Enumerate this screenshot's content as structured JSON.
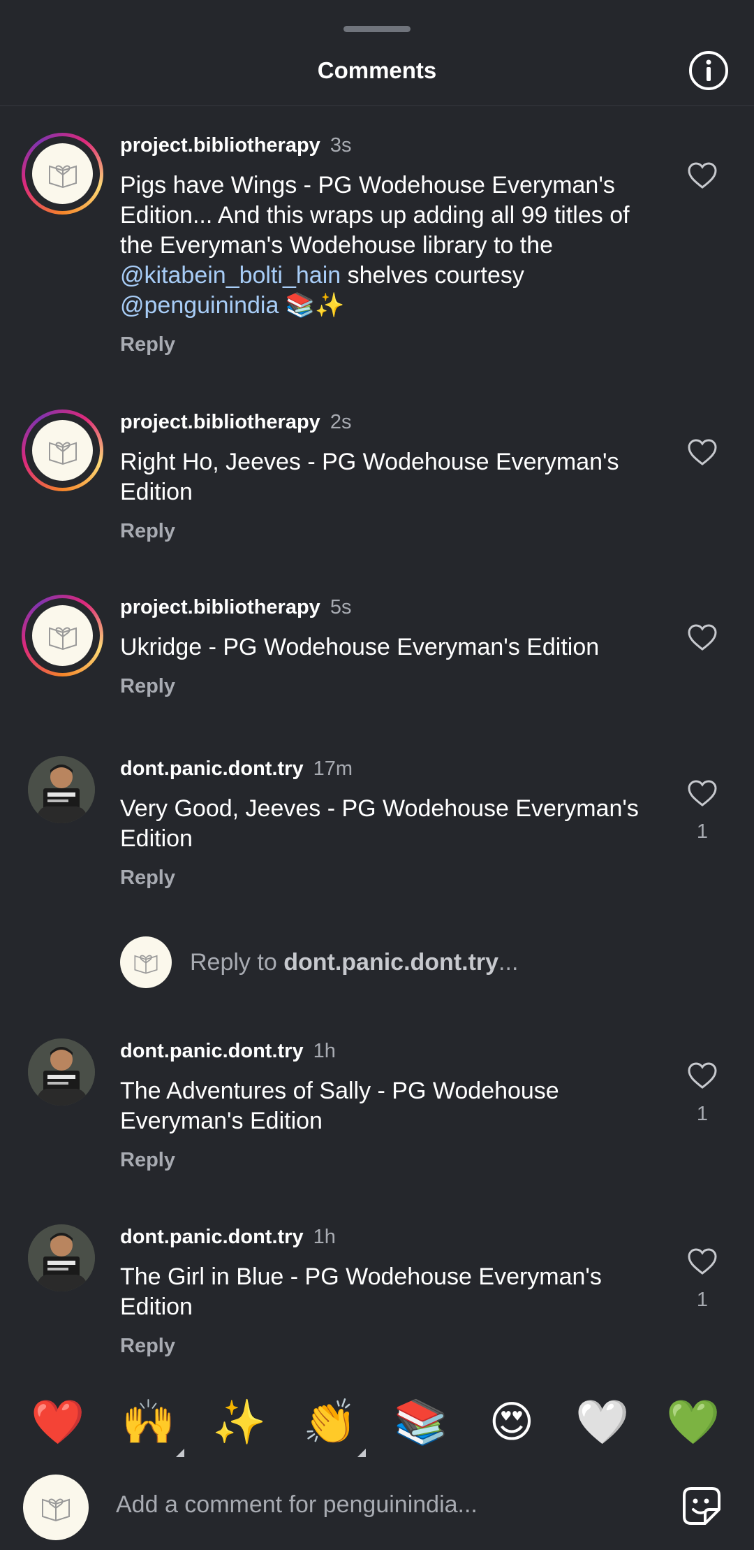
{
  "header": {
    "title": "Comments",
    "info_icon": "info-icon"
  },
  "comments": [
    {
      "username": "project.bibliotherapy",
      "time": "3s",
      "text_before": "Pigs have Wings - PG Wodehouse Everyman's Edition... And this wraps up adding all 99 titles of the Everyman's Wodehouse library to the ",
      "mention1": "@kitabein_bolti_hain",
      "text_middle": " shelves courtesy ",
      "mention2": "@penguinindia",
      "text_after": " 📚✨",
      "reply": "Reply"
    },
    {
      "username": "project.bibliotherapy",
      "time": "2s",
      "text": "Right Ho, Jeeves - PG Wodehouse Everyman's Edition",
      "reply": "Reply"
    },
    {
      "username": "project.bibliotherapy",
      "time": "5s",
      "text": "Ukridge - PG Wodehouse Everyman's Edition",
      "reply": "Reply"
    },
    {
      "username": "dont.panic.dont.try",
      "time": "17m",
      "text": "Very Good, Jeeves - PG Wodehouse Everyman's Edition",
      "reply": "Reply",
      "likes": "1"
    },
    {
      "username": "dont.panic.dont.try",
      "time": "1h",
      "text": "The Adventures of Sally - PG Wodehouse Everyman's Edition",
      "reply": "Reply",
      "likes": "1"
    },
    {
      "username": "dont.panic.dont.try",
      "time": "1h",
      "text": "The Girl in Blue - PG Wodehouse Everyman's Edition",
      "reply": "Reply",
      "likes": "1"
    }
  ],
  "reply_input": {
    "prefix": "Reply to ",
    "target": "dont.panic.dont.try",
    "suffix": "..."
  },
  "emoji_bar": [
    "❤️",
    "🙌",
    "✨",
    "👏",
    "📚",
    "😍",
    "🤍",
    "💚"
  ],
  "composer": {
    "placeholder": "Add a comment for penguinindia...",
    "sticker_icon": "sticker-icon"
  },
  "colors": {
    "background": "#25272c",
    "mention": "#a8cdf7",
    "secondary_text": "#a8abb2"
  }
}
